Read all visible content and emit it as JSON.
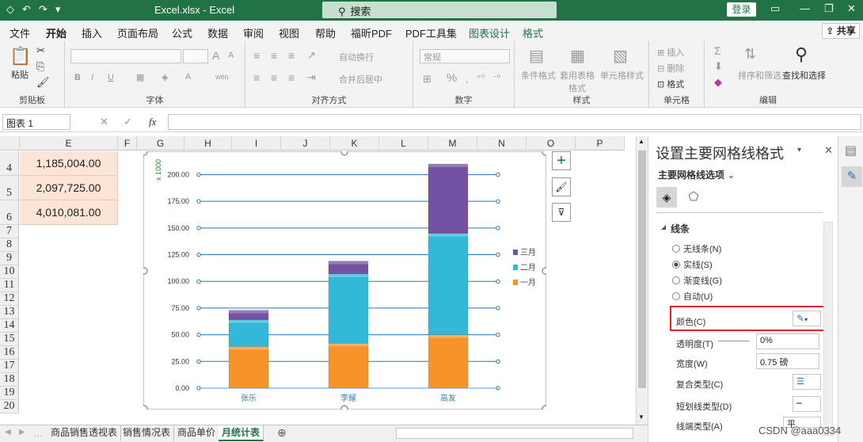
{
  "window": {
    "title": "Excel.xlsx  -  Excel",
    "search_placeholder": "搜索",
    "login": "登录"
  },
  "menu": {
    "tabs": [
      "文件",
      "开始",
      "插入",
      "页面布局",
      "公式",
      "数据",
      "审阅",
      "视图",
      "帮助",
      "福昕PDF",
      "PDF工具集",
      "图表设计",
      "格式"
    ],
    "share": "共享"
  },
  "ribbon": {
    "clipboard": {
      "label": "剪贴板",
      "paste": "粘贴"
    },
    "font": {
      "label": "字体",
      "bold": "B",
      "italic": "I",
      "underline": "U",
      "size_up": "A",
      "size_down": "A",
      "wen": "wén"
    },
    "align": {
      "label": "对齐方式",
      "wrap": "自动换行",
      "merge": "合并后居中"
    },
    "number": {
      "label": "数字",
      "format": "常规",
      "percent": "%"
    },
    "styles": {
      "label": "样式",
      "cond": "条件格式",
      "table": "套用表格格式",
      "cell": "单元格样式"
    },
    "cells": {
      "label": "单元格",
      "insert": "插入",
      "delete": "删除",
      "format": "格式"
    },
    "edit": {
      "label": "编辑",
      "sort": "排序和筛选",
      "find": "查找和选择"
    }
  },
  "formula_bar": {
    "name_box": "图表 1",
    "fx": "fx"
  },
  "grid": {
    "columns": [
      "E",
      "F",
      "G",
      "H",
      "I",
      "J",
      "K",
      "L",
      "M",
      "N",
      "O",
      "P"
    ],
    "rows": [
      "4",
      "5",
      "6",
      "7",
      "8",
      "9",
      "10",
      "11",
      "12",
      "13",
      "14",
      "15",
      "16",
      "17",
      "18",
      "19",
      "20"
    ],
    "cells": [
      "1,185,004.00",
      "2,097,725.00",
      "4,010,081.00"
    ]
  },
  "chart_data": {
    "type": "bar",
    "stacked": true,
    "categories": [
      "张乐",
      "李耀",
      "高友"
    ],
    "series": [
      {
        "name": "一月",
        "values": [
          39,
          42,
          50
        ],
        "color": "#f6932b"
      },
      {
        "name": "二月",
        "values": [
          25,
          65,
          95
        ],
        "color": "#33b8d9"
      },
      {
        "name": "三月",
        "values": [
          9,
          12,
          65
        ],
        "color": "#7352a3"
      }
    ],
    "yticks": [
      "0.00",
      "25.00",
      "50.00",
      "75.00",
      "100.00",
      "125.00",
      "150.00",
      "175.00",
      "200.00"
    ],
    "ylim": [
      0,
      210
    ],
    "ylabel": "x 1000",
    "legend": "right",
    "grid": true,
    "gridline_color": "#2e75b6"
  },
  "sheet_tabs": [
    "商品销售透视表",
    "销售情况表",
    "商品单价",
    "月统计表"
  ],
  "pane": {
    "title": "设置主要网格线格式",
    "options": "主要网格线选项",
    "section": "线条",
    "radios": [
      "无线条(N)",
      "实线(S)",
      "渐变线(G)",
      "自动(U)"
    ],
    "color_label": "颜色(C)",
    "transparency_label": "透明度(T)",
    "transparency_value": "0%",
    "width_label": "宽度(W)",
    "width_value": "0.75 磅",
    "compound_label": "复合类型(C)",
    "dash_label": "短划线类型(D)",
    "cap_label": "线端类型(A)",
    "cap_value": "平"
  },
  "watermark": "CSDN @aaa0334"
}
